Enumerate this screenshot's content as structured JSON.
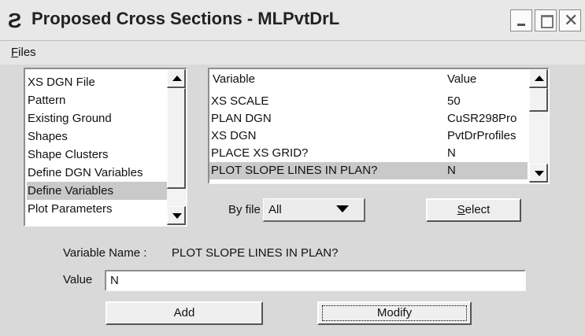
{
  "window": {
    "title": "Proposed Cross Sections - MLPvtDrL",
    "app_icon": "cross-section-app-icon",
    "controls": [
      "minimize-icon",
      "maximize-icon",
      "close-icon"
    ]
  },
  "menu": {
    "items": [
      {
        "label": "Files",
        "mnemonic": "F",
        "rest": "iles"
      }
    ]
  },
  "left_list": {
    "items": [
      {
        "label": "XS DGN File"
      },
      {
        "label": "Pattern"
      },
      {
        "label": "Existing Ground"
      },
      {
        "label": "Shapes"
      },
      {
        "label": "Shape Clusters"
      },
      {
        "label": "Define DGN Variables"
      },
      {
        "label": "Define Variables",
        "selected": true
      },
      {
        "label": "Plot Parameters"
      }
    ],
    "selected_index": 6
  },
  "var_table": {
    "headers": {
      "variable": "Variable",
      "value": "Value"
    },
    "rows": [
      {
        "variable": "XS SCALE",
        "value": "50"
      },
      {
        "variable": "PLAN DGN",
        "value": "CuSR298Pro"
      },
      {
        "variable": "XS DGN",
        "value": "PvtDrProfiles"
      },
      {
        "variable": "PLACE XS GRID?",
        "value": "N"
      },
      {
        "variable": "PLOT SLOPE LINES IN PLAN?",
        "value": "N",
        "selected": true
      }
    ]
  },
  "filter": {
    "label": "By file",
    "selected": "All"
  },
  "select_button": {
    "mnemonic": "S",
    "rest": "elect"
  },
  "detail": {
    "var_name_label": "Variable Name :",
    "var_name_value": "PLOT SLOPE LINES IN PLAN?",
    "value_label": "Value",
    "value": "N"
  },
  "buttons": {
    "add": "Add",
    "modify": "Modify"
  },
  "colors": {
    "selection": "#c9c9c9",
    "window_bg": "#d9d9d9"
  }
}
